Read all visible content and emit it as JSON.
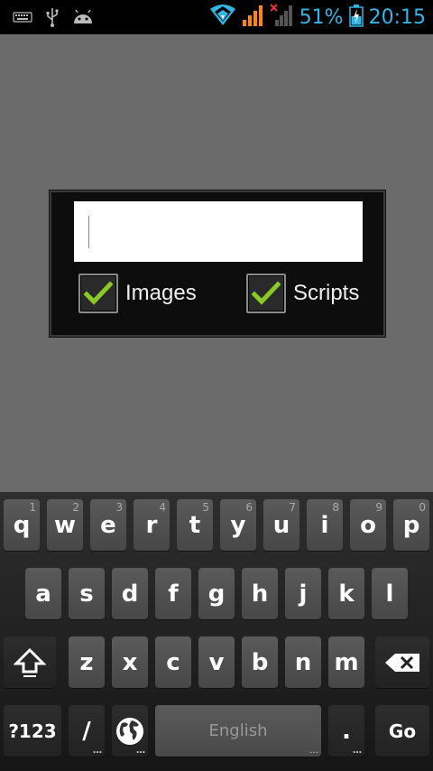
{
  "status_bar": {
    "battery_percent": "51%",
    "time": "20:15",
    "accent_color": "#33b5e5",
    "icons": [
      "keyboard-icon",
      "usb-icon",
      "android-debug-icon",
      "wifi-icon",
      "signal-orange-icon",
      "signal-no-service-icon",
      "battery-charging-icon"
    ]
  },
  "dialog": {
    "url_value": "",
    "checkboxes": [
      {
        "label": "Images",
        "checked": true
      },
      {
        "label": "Scripts",
        "checked": true
      }
    ]
  },
  "keyboard": {
    "row1": [
      {
        "label": "q",
        "hint": "1"
      },
      {
        "label": "w",
        "hint": "2"
      },
      {
        "label": "e",
        "hint": "3"
      },
      {
        "label": "r",
        "hint": "4"
      },
      {
        "label": "t",
        "hint": "5"
      },
      {
        "label": "y",
        "hint": "6"
      },
      {
        "label": "u",
        "hint": "7"
      },
      {
        "label": "i",
        "hint": "8"
      },
      {
        "label": "o",
        "hint": "9"
      },
      {
        "label": "p",
        "hint": "0"
      }
    ],
    "row2": [
      "a",
      "s",
      "d",
      "f",
      "g",
      "h",
      "j",
      "k",
      "l"
    ],
    "row3": [
      "z",
      "x",
      "c",
      "v",
      "b",
      "n",
      "m"
    ],
    "symbols_label": "?123",
    "slash_label": "/",
    "space_label": "English",
    "period_label": ".",
    "go_label": "Go"
  }
}
